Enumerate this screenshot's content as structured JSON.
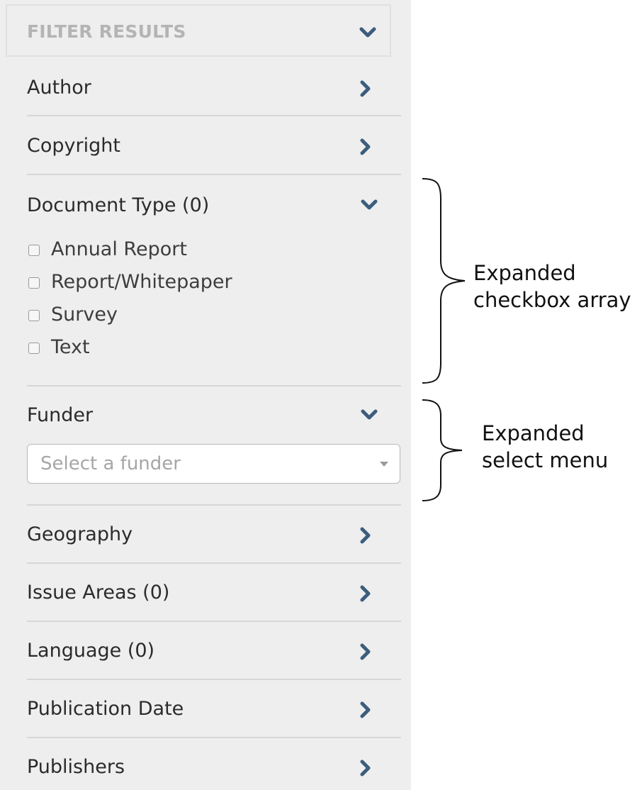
{
  "panel": {
    "header_title": "FILTER RESULTS",
    "sections": [
      {
        "label": "Author",
        "state": "collapsed"
      },
      {
        "label": "Copyright",
        "state": "collapsed"
      },
      {
        "label": "Document Type (0)",
        "state": "expanded"
      },
      {
        "label": "Funder",
        "state": "expanded"
      },
      {
        "label": "Geography",
        "state": "collapsed"
      },
      {
        "label": "Issue Areas (0)",
        "state": "collapsed"
      },
      {
        "label": "Language (0)",
        "state": "collapsed"
      },
      {
        "label": "Publication Date",
        "state": "collapsed"
      },
      {
        "label": "Publishers",
        "state": "collapsed"
      }
    ],
    "document_type_options": [
      {
        "label": "Annual Report",
        "checked": false
      },
      {
        "label": "Report/Whitepaper",
        "checked": false
      },
      {
        "label": "Survey",
        "checked": false
      },
      {
        "label": "Text",
        "checked": false
      }
    ],
    "funder_select": {
      "placeholder": "Select a funder",
      "value": ""
    }
  },
  "annotations": {
    "checkbox_array": {
      "line1": "Expanded",
      "line2": "checkbox array"
    },
    "select_menu": {
      "line1": "Expanded",
      "line2": "select menu"
    }
  },
  "colors": {
    "panel_bg": "#eeeeee",
    "chevron": "#3c5d7c",
    "divider": "#d6d6d6",
    "header_text": "#b4b4b4"
  },
  "icons": {
    "collapsed": "chevron-right-icon",
    "expanded": "chevron-down-icon",
    "select_caret": "caret-down-icon"
  }
}
